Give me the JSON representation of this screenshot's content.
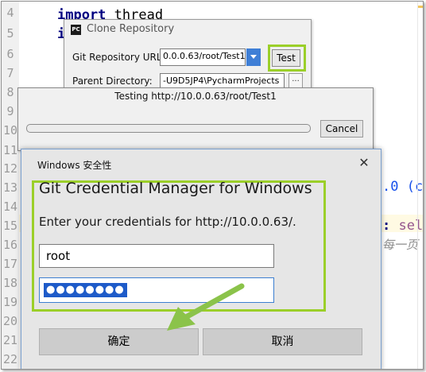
{
  "editor": {
    "line_numbers": [
      "4",
      "5",
      "6",
      "7",
      "8",
      "9",
      "10",
      "11",
      "12",
      "13",
      "14",
      "15",
      "16",
      "17",
      "18",
      "19",
      "20",
      "21",
      "22"
    ],
    "line3_keyword": "import",
    "line3_module": "thread",
    "line4_partial": "i",
    "right_fragment_13": ".0 (c",
    "right_fragment_15_colon": ":",
    "right_fragment_15_text": "sel",
    "right_fragment_16": "每一页"
  },
  "clone_dialog": {
    "icon_text": "PC",
    "title": "Clone Repository",
    "url_label": "Git Repository URL:",
    "url_value": "0.0.0.63/root/Test1",
    "test_button": "Test",
    "dir_label": "Parent Directory:",
    "dir_value": "-U9D5JP4\\PycharmProjects",
    "browse_button": "..."
  },
  "testing_dialog": {
    "title": "Testing http://10.0.0.63/root/Test1",
    "progress": 0.0,
    "cancel_button": "Cancel"
  },
  "security_dialog": {
    "title": "Windows 安全性",
    "close_glyph": "✕",
    "heading": "Git Credential Manager for Windows",
    "prompt": "Enter your credentials for http://10.0.0.63/.",
    "username": "root",
    "password_mask": "●●●●●●●●",
    "ok_button": "确定",
    "cancel_button": "取消"
  },
  "colors": {
    "highlight_green": "#9bcf29",
    "selection_blue": "#1e5bc9",
    "arrow_green": "#8bc34a"
  }
}
